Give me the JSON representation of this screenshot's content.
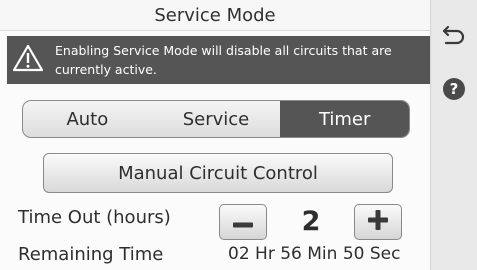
{
  "header": {
    "title": "Service Mode"
  },
  "warning": {
    "icon": "warning-triangle-icon",
    "text": "Enabling Service Mode will disable all circuits that are currently active."
  },
  "mode_selector": {
    "options": [
      {
        "label": "Auto",
        "active": false
      },
      {
        "label": "Service",
        "active": false
      },
      {
        "label": "Timer",
        "active": true
      }
    ]
  },
  "manual_button": {
    "label": "Manual Circuit Control"
  },
  "timeout": {
    "label": "Time Out (hours)",
    "value": "2",
    "decrement_label": "−",
    "increment_label": "+"
  },
  "remaining": {
    "label": "Remaining Time",
    "value": "02 Hr 56 Min 50 Sec"
  },
  "sidebar": {
    "back_icon": "back-arrow-icon",
    "help_icon": "help-icon",
    "help_glyph": "?"
  },
  "colors": {
    "active_segment": "#555555",
    "warning_banner": "#555555",
    "sidebar": "#e9e9e9"
  }
}
